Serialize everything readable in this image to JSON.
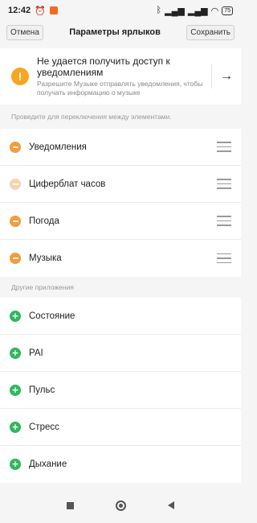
{
  "status_bar": {
    "time": "12:42",
    "battery": "75"
  },
  "header": {
    "cancel_label": "Отмена",
    "title": "Параметры ярлыков",
    "save_label": "Сохранить"
  },
  "banner": {
    "title": "Не удается получить доступ к уведомлениям",
    "subtitle": "Разрешите Музыке отправлять уведомления, чтобы получать информацию о музыке"
  },
  "hint": "Проведите для переключения между элементами.",
  "active_items": [
    {
      "label": "Уведомления",
      "disabled": false
    },
    {
      "label": "Циферблат часов",
      "disabled": true
    },
    {
      "label": "Погода",
      "disabled": false
    },
    {
      "label": "Музыка",
      "disabled": false
    }
  ],
  "other_title": "Другие приложения",
  "other_items": [
    {
      "label": "Состояние"
    },
    {
      "label": "PAI"
    },
    {
      "label": "Пульс"
    },
    {
      "label": "Стресс"
    },
    {
      "label": "Дыхание"
    }
  ],
  "colors": {
    "remove": "#f39c3c",
    "remove_disabled": "#f9d4ad",
    "add": "#2eb85c",
    "warning": "#f5a623"
  }
}
